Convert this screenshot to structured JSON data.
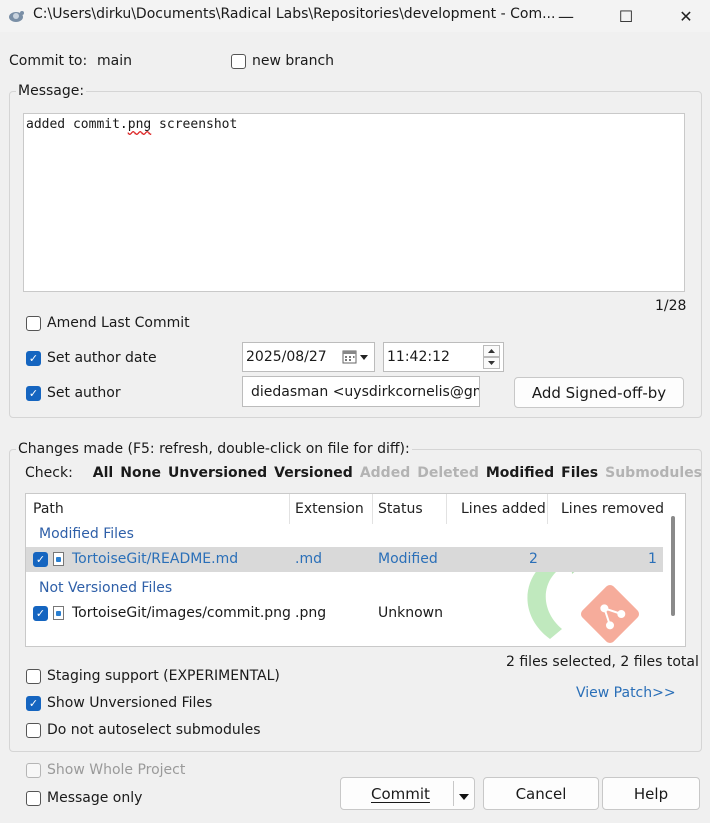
{
  "window": {
    "title": "C:\\Users\\dirku\\Documents\\Radical Labs\\Repositories\\development - Com...",
    "minimize": "—",
    "maximize": "☐",
    "close": "✕"
  },
  "commit_to": {
    "label": "Commit to:",
    "branch": "main",
    "new_branch_label": "new branch",
    "new_branch_checked": false
  },
  "message": {
    "group_label": "Message:",
    "text_before": "added commit.",
    "text_misspelled": "png",
    "text_after": " screenshot",
    "counter": "1/28"
  },
  "options": {
    "amend_label": "Amend Last Commit",
    "amend_checked": false,
    "set_author_date_label": "Set author date",
    "set_author_date_checked": true,
    "date_value": "2025/08/27",
    "time_value": "11:42:12",
    "set_author_label": "Set author",
    "set_author_checked": true,
    "author_value": "diedasman <uysdirkcornelis@gma",
    "signed_off_label": "Add Signed-off-by"
  },
  "changes": {
    "group_label": "Changes made (F5: refresh, double-click on file for diff):",
    "check_label": "Check:",
    "filters": [
      {
        "label": "All",
        "enabled": true
      },
      {
        "label": "None",
        "enabled": true
      },
      {
        "label": "Unversioned",
        "enabled": true
      },
      {
        "label": "Versioned",
        "enabled": true
      },
      {
        "label": "Added",
        "enabled": false
      },
      {
        "label": "Deleted",
        "enabled": false
      },
      {
        "label": "Modified",
        "enabled": true
      },
      {
        "label": "Files",
        "enabled": true
      },
      {
        "label": "Submodules",
        "enabled": false
      }
    ],
    "columns": [
      "Path",
      "Extension",
      "Status",
      "Lines added",
      "Lines removed"
    ],
    "groups": [
      {
        "name": "Modified Files",
        "files": [
          {
            "path": "TortoiseGit/README.md",
            "extension": ".md",
            "status": "Modified",
            "lines_added": "2",
            "lines_removed": "1",
            "checked": true
          }
        ]
      },
      {
        "name": "Not Versioned Files",
        "files": [
          {
            "path": "TortoiseGit/images/commit.png",
            "extension": ".png",
            "status": "Unknown",
            "lines_added": "",
            "lines_removed": "",
            "checked": true
          }
        ]
      }
    ],
    "summary": "2 files selected, 2 files total",
    "staging_label": "Staging support (EXPERIMENTAL)",
    "staging_checked": false,
    "show_unversioned_label": "Show Unversioned Files",
    "show_unversioned_checked": true,
    "no_autoselect_label": "Do not autoselect submodules",
    "no_autoselect_checked": false,
    "view_patch": "View Patch>>"
  },
  "footer": {
    "show_whole_project_label": "Show Whole Project",
    "message_only_label": "Message only",
    "commit_label": "Commit",
    "cancel_label": "Cancel",
    "help_label": "Help"
  },
  "colors": {
    "accent": "#1565c0",
    "link": "#2a6fb8",
    "selected_row": "#d9d9d9"
  }
}
